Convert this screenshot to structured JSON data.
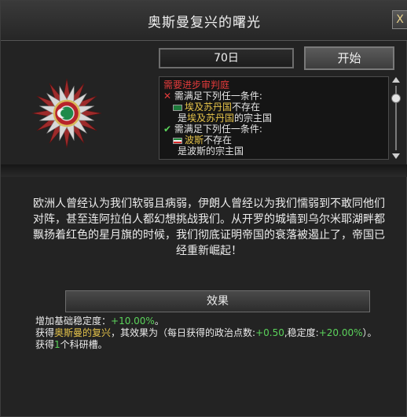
{
  "window": {
    "title": "奥斯曼复兴的曙光",
    "close_label": "X"
  },
  "header": {
    "days": "70日",
    "start_label": "开始"
  },
  "requirements": {
    "title": "需要进步审判庭",
    "group1_label": "需满足下列任一条件:",
    "egypt_name": "埃及苏丹国",
    "not_exist": "不存在",
    "is_prefix": "是",
    "overlord_suffix": "的宗主国",
    "group2_label": "需满足下列任一条件:",
    "persia_name": "波斯",
    "persia_not_exist": "不存在",
    "cut_line": "是波斯的宗主国"
  },
  "description": "欧洲人曾经认为我们软弱且病弱，伊朗人曾经以为我们懦弱到不敢同他们对阵，甚至连阿拉伯人都幻想挑战我们。从开罗的城墙到乌尔米耶湖畔都飘扬着红色的星月旗的时候，我们彻底证明帝国的衰落被遏止了，帝国已经重新崛起！",
  "effects": {
    "header": "效果",
    "l1_prefix": "增加基础稳定度：",
    "l1_value": "+10.00%",
    "l1_suffix": "。",
    "l2_prefix": "获得",
    "l2_modifier": "奥斯曼的复兴",
    "l2_mid": "，其效果为（每日获得的政治点数:",
    "l2_value1": "+0.50",
    "l2_mid2": ",稳定度:",
    "l2_value2": "+20.00%",
    "l2_end": "）。",
    "l3_prefix": "获得",
    "l3_value": "1",
    "l3_suffix": "个科研槽。"
  },
  "icons": {
    "emblem": "order-star-emblem-icon",
    "close": "close-icon",
    "fail": "cross-icon",
    "pass": "check-icon",
    "egypt_flag": "egypt-flag-icon",
    "persia_flag": "persia-flag-icon"
  },
  "colors": {
    "fail": "#e23b3b",
    "pass": "#5bd35b",
    "country": "#e5c34a",
    "positive": "#5bd35b"
  }
}
